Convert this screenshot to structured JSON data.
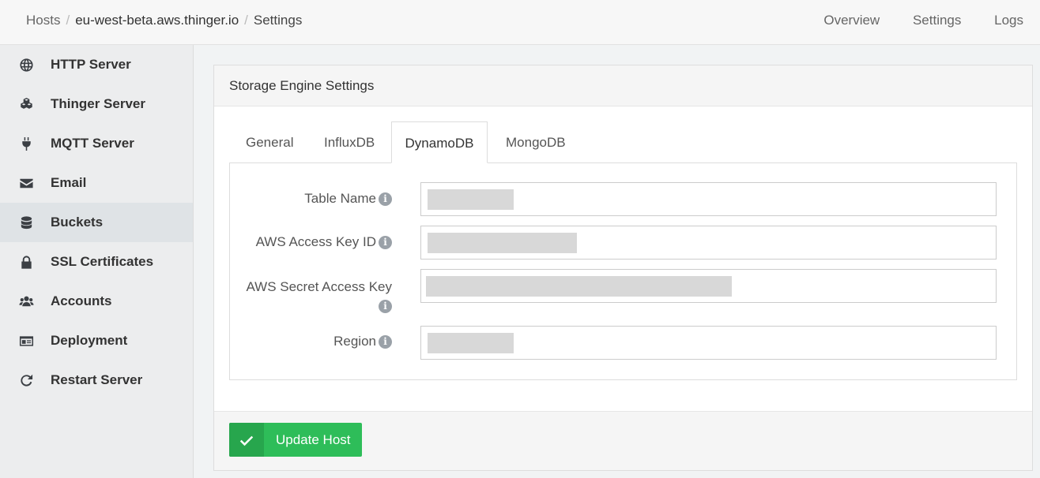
{
  "breadcrumb": {
    "hosts": "Hosts",
    "host": "eu-west-beta.aws.thinger.io",
    "current": "Settings"
  },
  "topnav": [
    "Overview",
    "Settings",
    "Logs"
  ],
  "sidebar": {
    "items": [
      {
        "label": "HTTP Server",
        "icon": "globe-icon"
      },
      {
        "label": "Thinger Server",
        "icon": "cubes-icon"
      },
      {
        "label": "MQTT Server",
        "icon": "plug-icon"
      },
      {
        "label": "Email",
        "icon": "envelope-icon"
      },
      {
        "label": "Buckets",
        "icon": "database-icon",
        "active": true
      },
      {
        "label": "SSL Certificates",
        "icon": "lock-icon"
      },
      {
        "label": "Accounts",
        "icon": "users-icon"
      },
      {
        "label": "Deployment",
        "icon": "id-card-icon"
      },
      {
        "label": "Restart Server",
        "icon": "redo-icon"
      }
    ]
  },
  "panel": {
    "title": "Storage Engine Settings",
    "tabs": [
      "General",
      "InfluxDB",
      "DynamoDB",
      "MongoDB"
    ],
    "active_tab": "DynamoDB",
    "fields": [
      {
        "label": "Table Name",
        "value_redacted": true
      },
      {
        "label": "AWS Access Key ID",
        "value_redacted": true
      },
      {
        "label": "AWS Secret Access Key",
        "value_redacted": true
      },
      {
        "label": "Region",
        "value_redacted": true
      }
    ],
    "submit_label": "Update Host"
  },
  "colors": {
    "accent_green": "#2ebd59",
    "sidebar_bg": "#ecedee",
    "active_item_bg": "#dfe3e6"
  }
}
